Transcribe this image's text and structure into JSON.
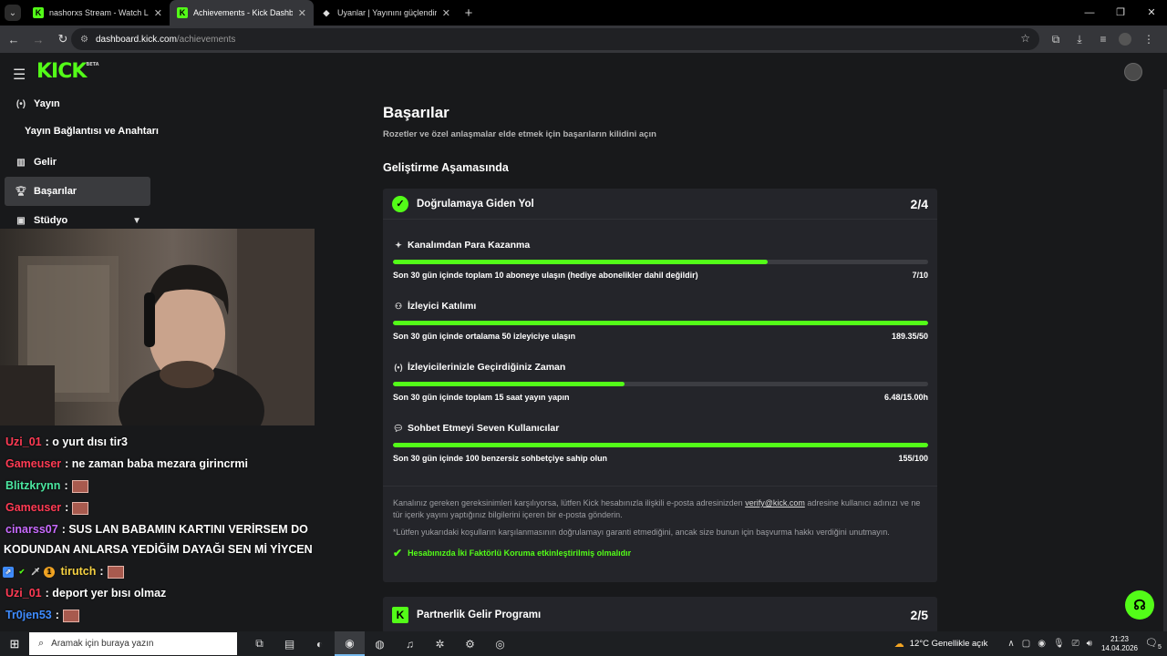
{
  "browser": {
    "tabs": [
      {
        "title": "nashorxs Stream - Watch Live o",
        "active": false
      },
      {
        "title": "Achievements - Kick Dashboard",
        "active": true
      },
      {
        "title": "Uyanlar | Yayınını güçlendirmek",
        "active": false
      }
    ],
    "url_domain": "dashboard.kick.com",
    "url_path": "/achievements"
  },
  "brand": {
    "logo": "KICK",
    "logo_tag": "BETA",
    "accent": "#53fc18"
  },
  "sidebar": {
    "items": [
      {
        "label": "Yayın",
        "icon": "broadcast-icon"
      },
      {
        "label": "Yayın Bağlantısı ve Anahtarı",
        "icon": ""
      },
      {
        "label": "Gelir",
        "icon": "chart-icon"
      },
      {
        "label": "Başarılar",
        "icon": "trophy-icon",
        "active": true
      },
      {
        "label": "Stüdyo",
        "icon": "studio-icon"
      }
    ]
  },
  "chat": [
    {
      "user": "Uzi_01",
      "color": "#ff3b54",
      "text": ": o yurt dısı tir3",
      "emote": false
    },
    {
      "user": "Gameuser",
      "color": "#ff3b54",
      "text": ": ne zaman baba mezara girincrmi",
      "emote": false
    },
    {
      "user": "Blitzkrynn",
      "color": "#4be6a0",
      "text": ":",
      "emote": true
    },
    {
      "user": "Gameuser",
      "color": "#ff3b54",
      "text": ":",
      "emote": true
    },
    {
      "user": "cinarss07",
      "color": "#c96bff",
      "text": ": SUS LAN BABAMIN KARTINI VERİRSEM DO",
      "emote": false
    },
    {
      "user": "",
      "color": "#ffffff",
      "text": "KODUNDAN ANLARSA YEDİĞİM DAYAĞI SEN Mİ YİYCEN",
      "emote": false
    },
    {
      "user": "tirutch",
      "color": "#f5d142",
      "text": ":",
      "emote": true
    },
    {
      "user": "Uzi_01",
      "color": "#ff3b54",
      "text": ": deport yer bısı olmaz",
      "emote": false
    },
    {
      "user": "Tr0jen53",
      "color": "#3f8cff",
      "text": ":",
      "emote": true
    }
  ],
  "page": {
    "title": "Başarılar",
    "subtitle": "Rozetler ve özel anlaşmalar elde etmek için başarıların kilidini açın",
    "section": "Geliştirme Aşamasında"
  },
  "verification_card": {
    "title": "Doğrulamaya Giden Yol",
    "count": "2/4",
    "goals": [
      {
        "icon": "sparkle-icon",
        "title": "Kanalımdan Para Kazanma",
        "desc": "Son 30 gün içinde toplam 10 aboneye ulaşın (hediye abonelikler dahil değildir)",
        "value": "7/10",
        "progress": 0.7
      },
      {
        "icon": "viewers-icon",
        "title": "İzleyici Katılımı",
        "desc": "Son 30 gün içinde ortalama 50 izleyiciye ulaşın",
        "value": "189.35/50",
        "progress": 1.0
      },
      {
        "icon": "signal-icon",
        "title": "İzleyicilerinizle Geçirdiğiniz Zaman",
        "desc": "Son 30 gün içinde toplam 15 saat yayın yapın",
        "value": "6.48/15.00h",
        "progress": 0.432
      },
      {
        "icon": "chat-icon",
        "title": "Sohbet Etmeyi Seven Kullanıcılar",
        "desc": "Son 30 gün içinde 100 benzersiz sohbetçiye sahip olun",
        "value": "155/100",
        "progress": 1.0
      }
    ],
    "note_before": "Kanalınız gereken gereksinimleri karşılıyorsa, lütfen Kick hesabınızla ilişkili e-posta adresinizden ",
    "note_link": "verify@kick.com",
    "note_after": " adresine kullanıcı adınızı ve ne tür içerik yayını yaptığınız bilgilerini içeren bir e-posta gönderin.",
    "disclaimer": "*Lütfen yukarıdaki koşulların karşılanmasının doğrulamayı garanti etmediğini, ancak size bunun için başvurma hakkı verdiğini unutmayın.",
    "requirement": "Hesabınızda İki Faktörlü Koruma etkinleştirilmiş olmalıdır"
  },
  "partner_card": {
    "title": "Partnerlik Gelir Programı",
    "count": "2/5"
  },
  "taskbar": {
    "search_placeholder": "Aramak için buraya yazın",
    "weather": "12°C  Genellikle açık",
    "time": "21:23",
    "date": "14.04.2026",
    "notif_count": "5"
  }
}
